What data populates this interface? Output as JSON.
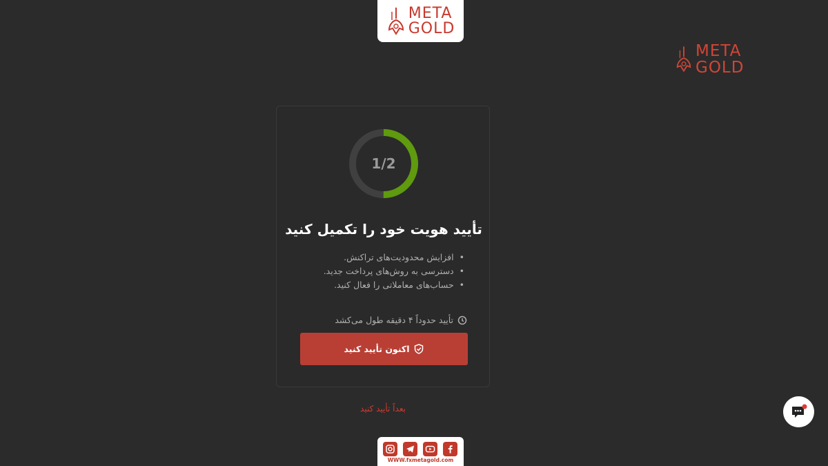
{
  "brand": {
    "line1": "META",
    "line2": "GOLD"
  },
  "progress": {
    "step_label": "1/2",
    "fraction": 0.5,
    "track_color": "#404040",
    "fill_color": "#5f9a0f"
  },
  "card": {
    "title": "تأیید هویت خود را تکمیل کنید",
    "benefits": [
      "افزایش محدودیت‌های تراکنش.",
      "دسترسی به روش‌های پرداخت جدید.",
      "حساب‌های معاملاتی را فعال کنید."
    ],
    "duration_text": "تأیید حدوداً ۴ دقیقه طول می‌کشد",
    "duration_icon": "clock-icon",
    "cta_label": "اکنون تأیید کنید",
    "cta_icon": "shield-check-icon",
    "cta_color": "#b93f35"
  },
  "later_link": "بعداً تأیید کنید",
  "social": {
    "icons": [
      "instagram-icon",
      "telegram-icon",
      "youtube-icon",
      "facebook-icon"
    ],
    "url": "WWW.fxmetagold.com"
  },
  "chat": {
    "icon": "chat-support-icon"
  }
}
